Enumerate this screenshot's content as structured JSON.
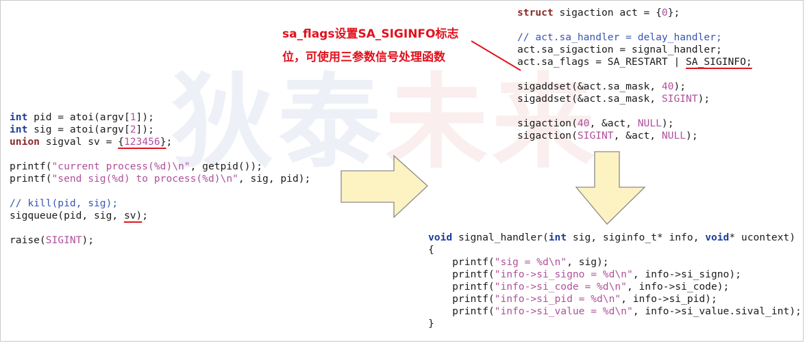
{
  "watermark": {
    "text": "狄泰未来"
  },
  "callout": {
    "line1": "sa_flags设置SA_SIGINFO标志",
    "line2": "位，可使用三参数信号处理函数"
  },
  "code_left": [
    [
      {
        "t": "int",
        "c": "kwt"
      },
      {
        "t": " pid = atoi(argv["
      },
      {
        "t": "1",
        "c": "num"
      },
      {
        "t": "]);"
      }
    ],
    [
      {
        "t": "int",
        "c": "kwt"
      },
      {
        "t": " sig = atoi(argv["
      },
      {
        "t": "2",
        "c": "num"
      },
      {
        "t": "]);"
      }
    ],
    [
      {
        "t": "union",
        "c": "kw"
      },
      {
        "t": " sigval sv = "
      },
      {
        "t": "{",
        "c": "ul"
      },
      {
        "t": "123456",
        "c": "num ul"
      },
      {
        "t": "}",
        "c": "ul"
      },
      {
        "t": ";"
      }
    ],
    [
      {
        "t": ""
      }
    ],
    [
      {
        "t": "printf("
      },
      {
        "t": "\"current process(%d)\\n\"",
        "c": "str"
      },
      {
        "t": ", getpid());"
      }
    ],
    [
      {
        "t": "printf("
      },
      {
        "t": "\"send sig(%d) to process(%d)\\n\"",
        "c": "str"
      },
      {
        "t": ", sig, pid);"
      }
    ],
    [
      {
        "t": ""
      }
    ],
    [
      {
        "t": "// kill(pid, sig);",
        "c": "cmt"
      }
    ],
    [
      {
        "t": "sigqueue(pid, sig, "
      },
      {
        "t": "sv)",
        "c": "ul"
      },
      {
        "t": ";"
      }
    ],
    [
      {
        "t": ""
      }
    ],
    [
      {
        "t": "raise("
      },
      {
        "t": "SIGINT",
        "c": "cst"
      },
      {
        "t": ");"
      }
    ]
  ],
  "code_right_top": [
    [
      {
        "t": "struct",
        "c": "kw"
      },
      {
        "t": " sigaction act = {"
      },
      {
        "t": "0",
        "c": "num"
      },
      {
        "t": "};"
      }
    ],
    [
      {
        "t": ""
      }
    ],
    [
      {
        "t": "// act.sa_handler = delay_handler;",
        "c": "cmt"
      }
    ],
    [
      {
        "t": "act.sa_sigaction = signal_handler;"
      }
    ],
    [
      {
        "t": "act.sa_flags = SA_RESTART | "
      },
      {
        "t": "SA_SIGINFO;",
        "c": "ul"
      }
    ],
    [
      {
        "t": ""
      }
    ],
    [
      {
        "t": "sigaddset(&act.sa_mask, "
      },
      {
        "t": "40",
        "c": "num"
      },
      {
        "t": ");"
      }
    ],
    [
      {
        "t": "sigaddset(&act.sa_mask, "
      },
      {
        "t": "SIGINT",
        "c": "cst"
      },
      {
        "t": ");"
      }
    ],
    [
      {
        "t": ""
      }
    ],
    [
      {
        "t": "sigaction("
      },
      {
        "t": "40",
        "c": "num"
      },
      {
        "t": ", &act, "
      },
      {
        "t": "NULL",
        "c": "cst"
      },
      {
        "t": ");"
      }
    ],
    [
      {
        "t": "sigaction("
      },
      {
        "t": "SIGINT",
        "c": "cst"
      },
      {
        "t": ", &act, "
      },
      {
        "t": "NULL",
        "c": "cst"
      },
      {
        "t": ");"
      }
    ]
  ],
  "code_right_bottom": [
    [
      {
        "t": "void",
        "c": "kwt"
      },
      {
        "t": " signal_handler("
      },
      {
        "t": "int",
        "c": "kwt"
      },
      {
        "t": " sig, siginfo_t* info, "
      },
      {
        "t": "void",
        "c": "kwt"
      },
      {
        "t": "* ucontext)"
      }
    ],
    [
      {
        "t": "{"
      }
    ],
    [
      {
        "t": "    printf("
      },
      {
        "t": "\"sig = %d\\n\"",
        "c": "str"
      },
      {
        "t": ", sig);"
      }
    ],
    [
      {
        "t": "    printf("
      },
      {
        "t": "\"info->si_signo = %d\\n\"",
        "c": "str"
      },
      {
        "t": ", info->si_signo);"
      }
    ],
    [
      {
        "t": "    printf("
      },
      {
        "t": "\"info->si_code = %d\\n\"",
        "c": "str"
      },
      {
        "t": ", info->si_code);"
      }
    ],
    [
      {
        "t": "    printf("
      },
      {
        "t": "\"info->si_pid = %d\\n\"",
        "c": "str"
      },
      {
        "t": ", info->si_pid);"
      }
    ],
    [
      {
        "t": "    printf("
      },
      {
        "t": "\"info->si_value = %d\\n\"",
        "c": "str"
      },
      {
        "t": ", info->si_value.sival_int);"
      }
    ],
    [
      {
        "t": "}"
      }
    ]
  ],
  "colors": {
    "accent_red": "#e0121e",
    "arrow_fill": "#fdf3c2",
    "arrow_stroke": "#8a8a8a",
    "watermark": [
      "#1d3aa6",
      "#1d3aa6",
      "#c41a1a",
      "#c41a1a"
    ]
  }
}
